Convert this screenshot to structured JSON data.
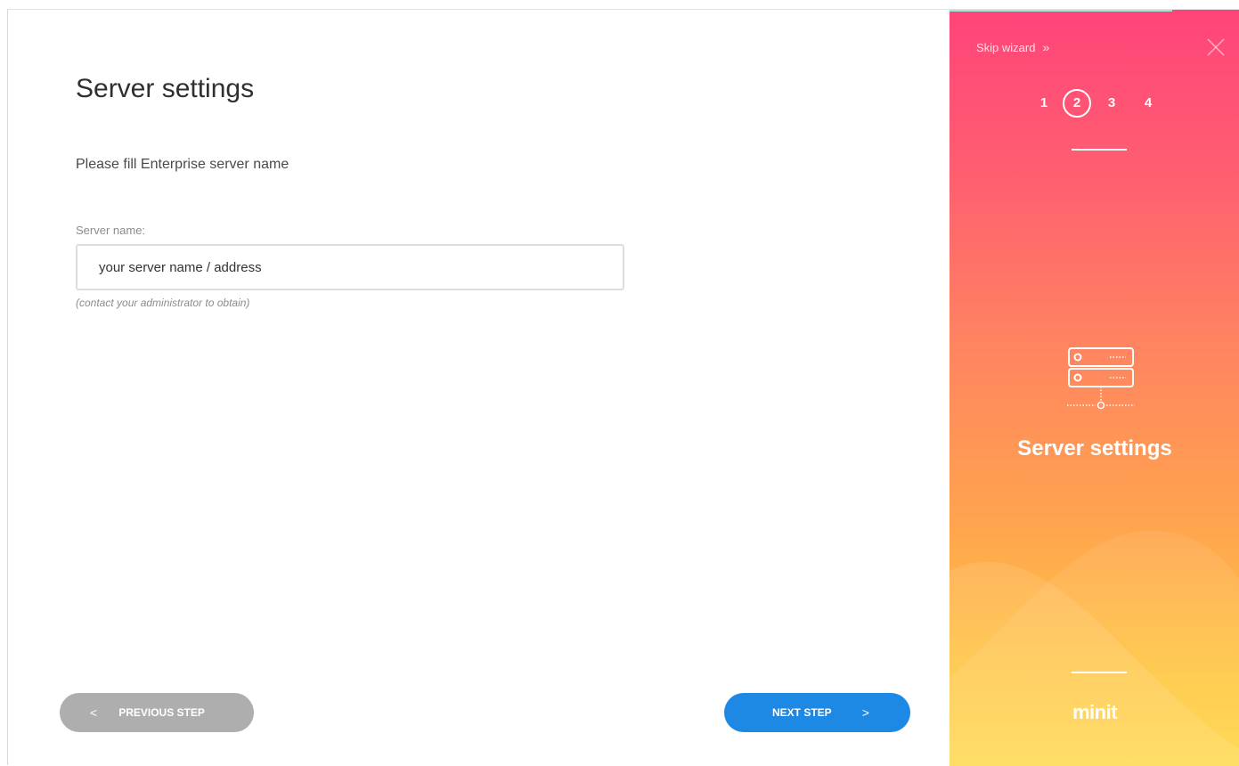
{
  "main": {
    "title": "Server settings",
    "subtitle": "Please fill Enterprise server name",
    "server_field": {
      "label": "Server name:",
      "placeholder": "your server name / address",
      "value": "",
      "hint": "(contact your administrator to obtain)"
    },
    "prev_button": {
      "label": "PREVIOUS STEP",
      "icon": "chevron-left-icon"
    },
    "next_button": {
      "label": "NEXT STEP",
      "icon": "chevron-right-icon"
    }
  },
  "sidebar": {
    "skip_label": "Skip wizard",
    "skip_icon": "double-chevron-right-icon",
    "close_icon": "close-icon",
    "steps": [
      "1",
      "2",
      "3",
      "4"
    ],
    "active_step": "2",
    "section_icon": "server-icon",
    "section_title": "Server settings",
    "brand": "minit"
  },
  "colors": {
    "primary_button": "#1e88e5",
    "disabled_button": "#aeaeae",
    "gradient_top": "#ff447a",
    "gradient_bottom": "#ffd84a"
  }
}
